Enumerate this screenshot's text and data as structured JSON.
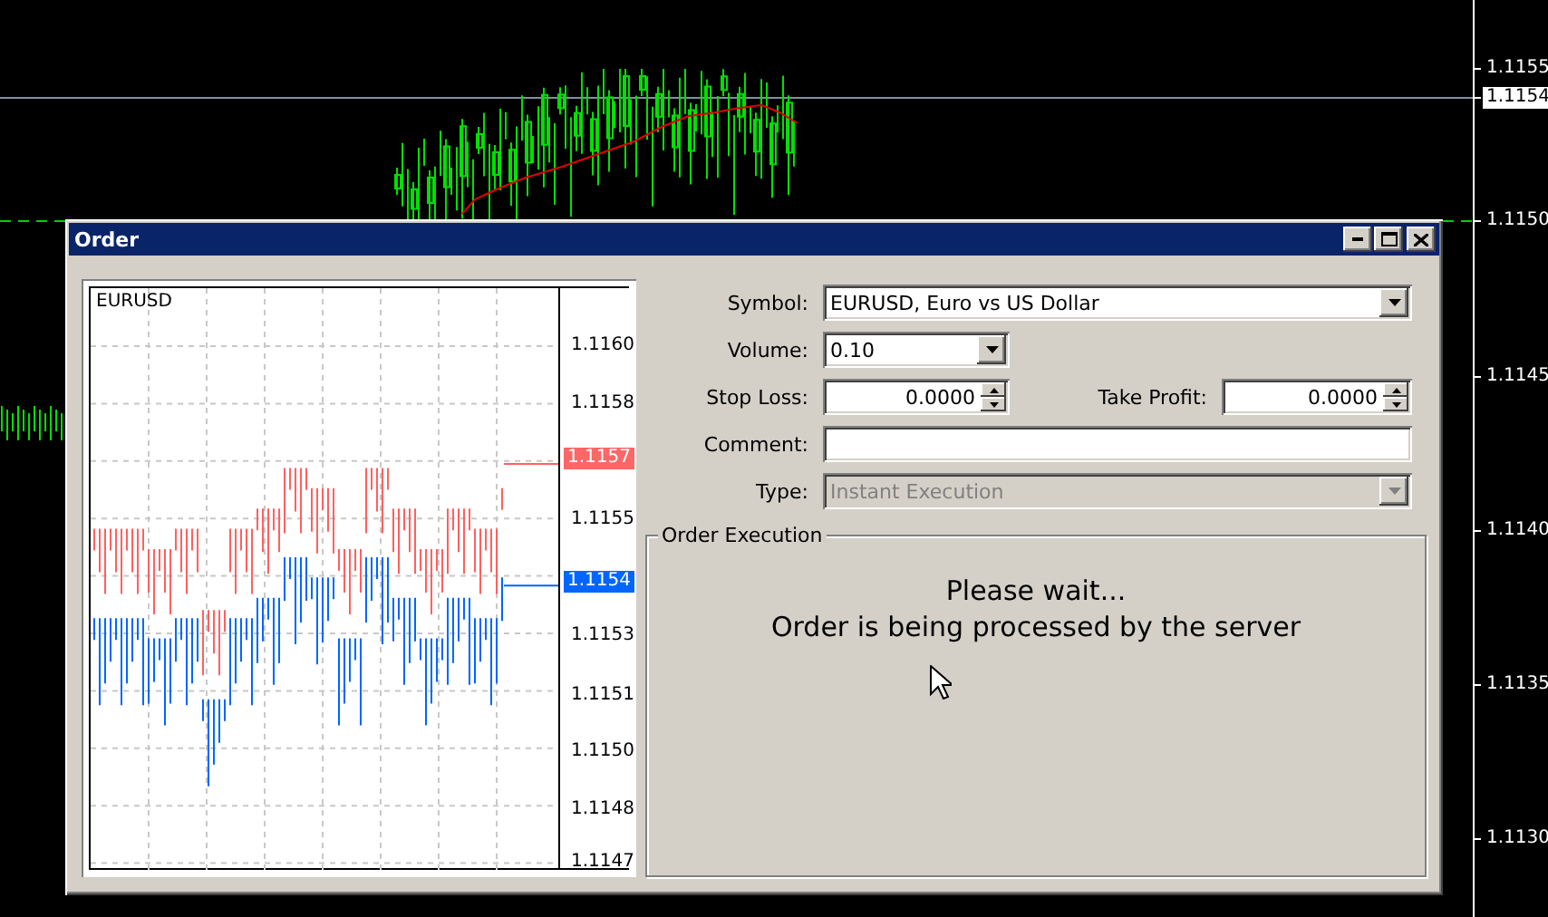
{
  "background_chart": {
    "price_labels": [
      {
        "text": "1.1155",
        "kind": "tick"
      },
      {
        "text": "1.1154",
        "kind": "current"
      },
      {
        "text": "1.1150",
        "kind": "tick"
      },
      {
        "text": "1.1145",
        "kind": "tick"
      },
      {
        "text": "1.1140",
        "kind": "tick"
      },
      {
        "text": "1.1135",
        "kind": "tick"
      },
      {
        "text": "1.1130",
        "kind": "tick"
      }
    ]
  },
  "window": {
    "title": "Order"
  },
  "tick_chart": {
    "symbol": "EURUSD",
    "price_labels": [
      {
        "text": "1.1160",
        "kind": "tick"
      },
      {
        "text": "1.1158",
        "kind": "tick"
      },
      {
        "text": "1.1157",
        "kind": "ask"
      },
      {
        "text": "1.1155",
        "kind": "tick"
      },
      {
        "text": "1.1154",
        "kind": "bid"
      },
      {
        "text": "1.1153",
        "kind": "tick"
      },
      {
        "text": "1.1151",
        "kind": "tick"
      },
      {
        "text": "1.1150",
        "kind": "tick"
      },
      {
        "text": "1.1148",
        "kind": "tick"
      },
      {
        "text": "1.1147",
        "kind": "tick"
      }
    ]
  },
  "form": {
    "symbol": {
      "label": "Symbol:",
      "value": "EURUSD, Euro vs US Dollar"
    },
    "volume": {
      "label": "Volume:",
      "value": "0.10"
    },
    "stop_loss": {
      "label": "Stop Loss:",
      "value": "0.0000"
    },
    "take_profit": {
      "label": "Take Profit:",
      "value": "0.0000"
    },
    "comment": {
      "label": "Comment:"
    },
    "type": {
      "label": "Type:",
      "value": "Instant Execution",
      "disabled": true
    }
  },
  "execution": {
    "title": "Order Execution",
    "message": [
      "Please wait...",
      "Order is being processed by the server"
    ]
  }
}
